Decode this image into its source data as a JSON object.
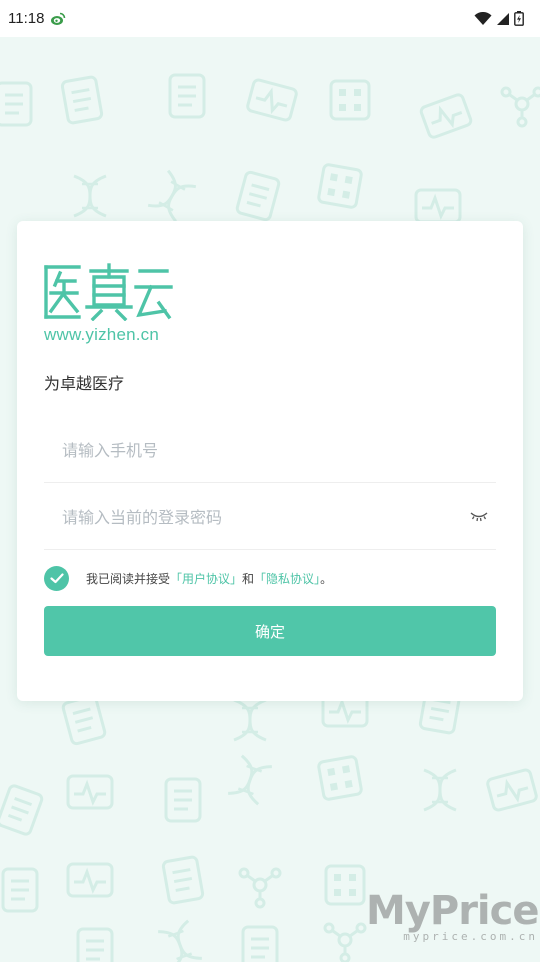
{
  "status_bar": {
    "time": "11:18",
    "app_icon": "weibo-icon",
    "icons": [
      "wifi-icon",
      "signal-icon",
      "battery-icon"
    ]
  },
  "brand": {
    "logo_text": "医真云",
    "url": "www.yizhen.cn",
    "tagline": "为卓越医疗",
    "accent_color": "#4ec4a7"
  },
  "form": {
    "phone_placeholder": "请输入手机号",
    "password_placeholder": "请输入当前的登录密码",
    "password_toggle_icon": "eye-closed-icon",
    "agreement_checked": true,
    "agreement_prefix": "我已阅读并接受",
    "user_agreement_link": "「用户协议」",
    "agreement_and": "和",
    "privacy_link": "「隐私协议」",
    "agreement_suffix": "。",
    "confirm_label": "确定"
  },
  "watermark": {
    "main": "MyPrice",
    "sub": "myprice.com.cn"
  }
}
